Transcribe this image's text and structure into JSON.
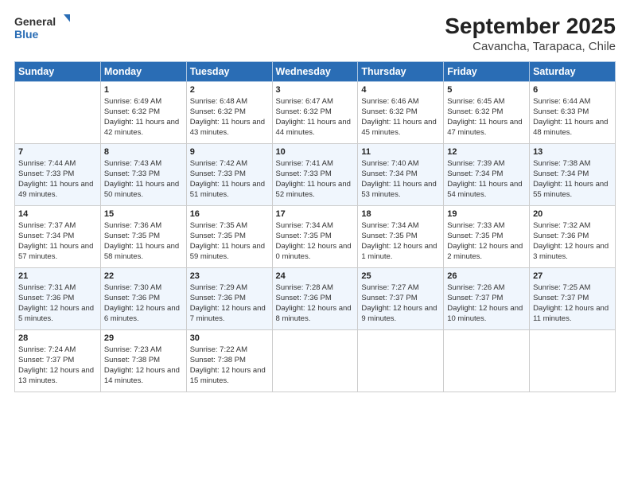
{
  "logo": {
    "line1": "General",
    "line2": "Blue"
  },
  "title": "September 2025",
  "subtitle": "Cavancha, Tarapaca, Chile",
  "days_header": [
    "Sunday",
    "Monday",
    "Tuesday",
    "Wednesday",
    "Thursday",
    "Friday",
    "Saturday"
  ],
  "weeks": [
    [
      {
        "day": "",
        "sunrise": "",
        "sunset": "",
        "daylight": ""
      },
      {
        "day": "1",
        "sunrise": "Sunrise: 6:49 AM",
        "sunset": "Sunset: 6:32 PM",
        "daylight": "Daylight: 11 hours and 42 minutes."
      },
      {
        "day": "2",
        "sunrise": "Sunrise: 6:48 AM",
        "sunset": "Sunset: 6:32 PM",
        "daylight": "Daylight: 11 hours and 43 minutes."
      },
      {
        "day": "3",
        "sunrise": "Sunrise: 6:47 AM",
        "sunset": "Sunset: 6:32 PM",
        "daylight": "Daylight: 11 hours and 44 minutes."
      },
      {
        "day": "4",
        "sunrise": "Sunrise: 6:46 AM",
        "sunset": "Sunset: 6:32 PM",
        "daylight": "Daylight: 11 hours and 45 minutes."
      },
      {
        "day": "5",
        "sunrise": "Sunrise: 6:45 AM",
        "sunset": "Sunset: 6:32 PM",
        "daylight": "Daylight: 11 hours and 47 minutes."
      },
      {
        "day": "6",
        "sunrise": "Sunrise: 6:44 AM",
        "sunset": "Sunset: 6:33 PM",
        "daylight": "Daylight: 11 hours and 48 minutes."
      }
    ],
    [
      {
        "day": "7",
        "sunrise": "Sunrise: 7:44 AM",
        "sunset": "Sunset: 7:33 PM",
        "daylight": "Daylight: 11 hours and 49 minutes."
      },
      {
        "day": "8",
        "sunrise": "Sunrise: 7:43 AM",
        "sunset": "Sunset: 7:33 PM",
        "daylight": "Daylight: 11 hours and 50 minutes."
      },
      {
        "day": "9",
        "sunrise": "Sunrise: 7:42 AM",
        "sunset": "Sunset: 7:33 PM",
        "daylight": "Daylight: 11 hours and 51 minutes."
      },
      {
        "day": "10",
        "sunrise": "Sunrise: 7:41 AM",
        "sunset": "Sunset: 7:33 PM",
        "daylight": "Daylight: 11 hours and 52 minutes."
      },
      {
        "day": "11",
        "sunrise": "Sunrise: 7:40 AM",
        "sunset": "Sunset: 7:34 PM",
        "daylight": "Daylight: 11 hours and 53 minutes."
      },
      {
        "day": "12",
        "sunrise": "Sunrise: 7:39 AM",
        "sunset": "Sunset: 7:34 PM",
        "daylight": "Daylight: 11 hours and 54 minutes."
      },
      {
        "day": "13",
        "sunrise": "Sunrise: 7:38 AM",
        "sunset": "Sunset: 7:34 PM",
        "daylight": "Daylight: 11 hours and 55 minutes."
      }
    ],
    [
      {
        "day": "14",
        "sunrise": "Sunrise: 7:37 AM",
        "sunset": "Sunset: 7:34 PM",
        "daylight": "Daylight: 11 hours and 57 minutes."
      },
      {
        "day": "15",
        "sunrise": "Sunrise: 7:36 AM",
        "sunset": "Sunset: 7:35 PM",
        "daylight": "Daylight: 11 hours and 58 minutes."
      },
      {
        "day": "16",
        "sunrise": "Sunrise: 7:35 AM",
        "sunset": "Sunset: 7:35 PM",
        "daylight": "Daylight: 11 hours and 59 minutes."
      },
      {
        "day": "17",
        "sunrise": "Sunrise: 7:34 AM",
        "sunset": "Sunset: 7:35 PM",
        "daylight": "Daylight: 12 hours and 0 minutes."
      },
      {
        "day": "18",
        "sunrise": "Sunrise: 7:34 AM",
        "sunset": "Sunset: 7:35 PM",
        "daylight": "Daylight: 12 hours and 1 minute."
      },
      {
        "day": "19",
        "sunrise": "Sunrise: 7:33 AM",
        "sunset": "Sunset: 7:35 PM",
        "daylight": "Daylight: 12 hours and 2 minutes."
      },
      {
        "day": "20",
        "sunrise": "Sunrise: 7:32 AM",
        "sunset": "Sunset: 7:36 PM",
        "daylight": "Daylight: 12 hours and 3 minutes."
      }
    ],
    [
      {
        "day": "21",
        "sunrise": "Sunrise: 7:31 AM",
        "sunset": "Sunset: 7:36 PM",
        "daylight": "Daylight: 12 hours and 5 minutes."
      },
      {
        "day": "22",
        "sunrise": "Sunrise: 7:30 AM",
        "sunset": "Sunset: 7:36 PM",
        "daylight": "Daylight: 12 hours and 6 minutes."
      },
      {
        "day": "23",
        "sunrise": "Sunrise: 7:29 AM",
        "sunset": "Sunset: 7:36 PM",
        "daylight": "Daylight: 12 hours and 7 minutes."
      },
      {
        "day": "24",
        "sunrise": "Sunrise: 7:28 AM",
        "sunset": "Sunset: 7:36 PM",
        "daylight": "Daylight: 12 hours and 8 minutes."
      },
      {
        "day": "25",
        "sunrise": "Sunrise: 7:27 AM",
        "sunset": "Sunset: 7:37 PM",
        "daylight": "Daylight: 12 hours and 9 minutes."
      },
      {
        "day": "26",
        "sunrise": "Sunrise: 7:26 AM",
        "sunset": "Sunset: 7:37 PM",
        "daylight": "Daylight: 12 hours and 10 minutes."
      },
      {
        "day": "27",
        "sunrise": "Sunrise: 7:25 AM",
        "sunset": "Sunset: 7:37 PM",
        "daylight": "Daylight: 12 hours and 11 minutes."
      }
    ],
    [
      {
        "day": "28",
        "sunrise": "Sunrise: 7:24 AM",
        "sunset": "Sunset: 7:37 PM",
        "daylight": "Daylight: 12 hours and 13 minutes."
      },
      {
        "day": "29",
        "sunrise": "Sunrise: 7:23 AM",
        "sunset": "Sunset: 7:38 PM",
        "daylight": "Daylight: 12 hours and 14 minutes."
      },
      {
        "day": "30",
        "sunrise": "Sunrise: 7:22 AM",
        "sunset": "Sunset: 7:38 PM",
        "daylight": "Daylight: 12 hours and 15 minutes."
      },
      {
        "day": "",
        "sunrise": "",
        "sunset": "",
        "daylight": ""
      },
      {
        "day": "",
        "sunrise": "",
        "sunset": "",
        "daylight": ""
      },
      {
        "day": "",
        "sunrise": "",
        "sunset": "",
        "daylight": ""
      },
      {
        "day": "",
        "sunrise": "",
        "sunset": "",
        "daylight": ""
      }
    ]
  ]
}
